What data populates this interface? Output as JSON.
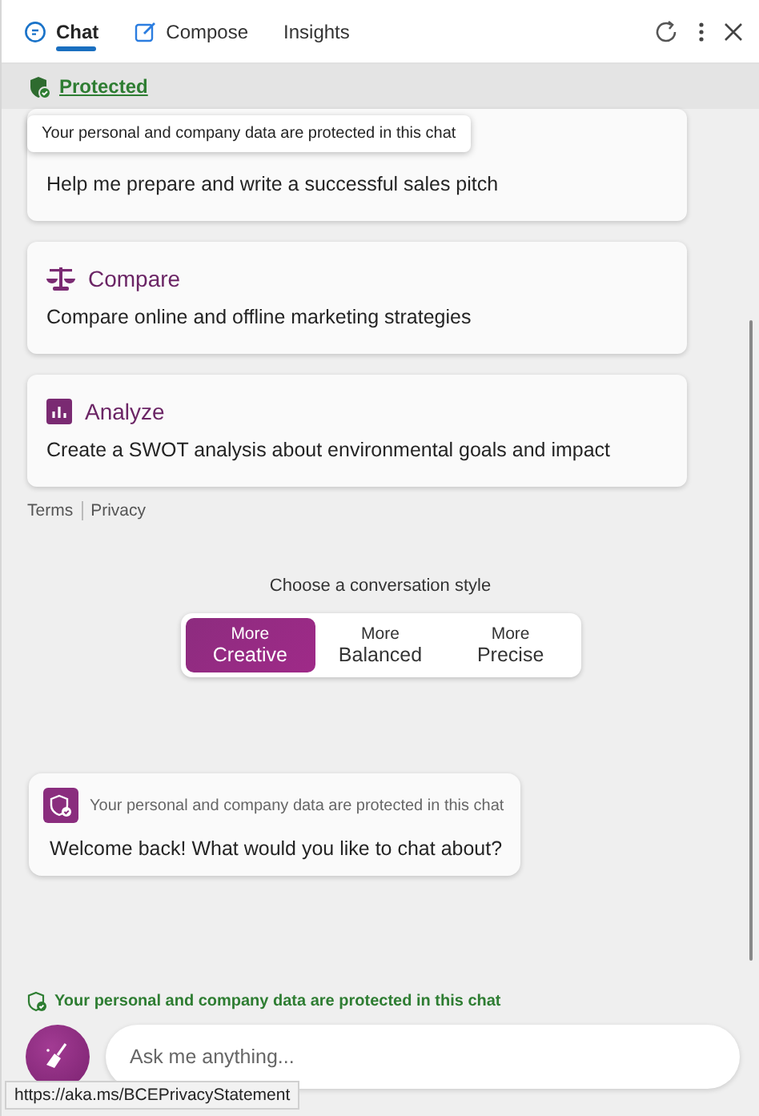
{
  "tabs": [
    {
      "label": "Chat",
      "selected": true
    },
    {
      "label": "Compose",
      "selected": false
    },
    {
      "label": "Insights",
      "selected": false
    }
  ],
  "protected_link": "Protected",
  "tooltip": "Your personal and company data are protected in this chat",
  "prompt_cards": [
    {
      "description": "Help me prepare and write a successful sales pitch"
    },
    {
      "title": "Compare",
      "description": "Compare online and offline marketing strategies"
    },
    {
      "title": "Analyze",
      "description": "Create a SWOT analysis about environmental goals and impact"
    }
  ],
  "footer_links": [
    "Terms",
    "Privacy"
  ],
  "conversation_style": {
    "label": "Choose a conversation style",
    "options": [
      {
        "line1": "More",
        "line2": "Creative",
        "selected": true
      },
      {
        "line1": "More",
        "line2": "Balanced",
        "selected": false
      },
      {
        "line1": "More",
        "line2": "Precise",
        "selected": false
      }
    ]
  },
  "welcome": {
    "notice": "Your personal and company data are protected in this chat",
    "message": "Welcome back! What would you like to chat about?"
  },
  "protection_note": "Your personal and company data are protected in this chat",
  "input": {
    "placeholder": "Ask me anything..."
  },
  "status_url": "https://aka.ms/BCEPrivacyStatement"
}
